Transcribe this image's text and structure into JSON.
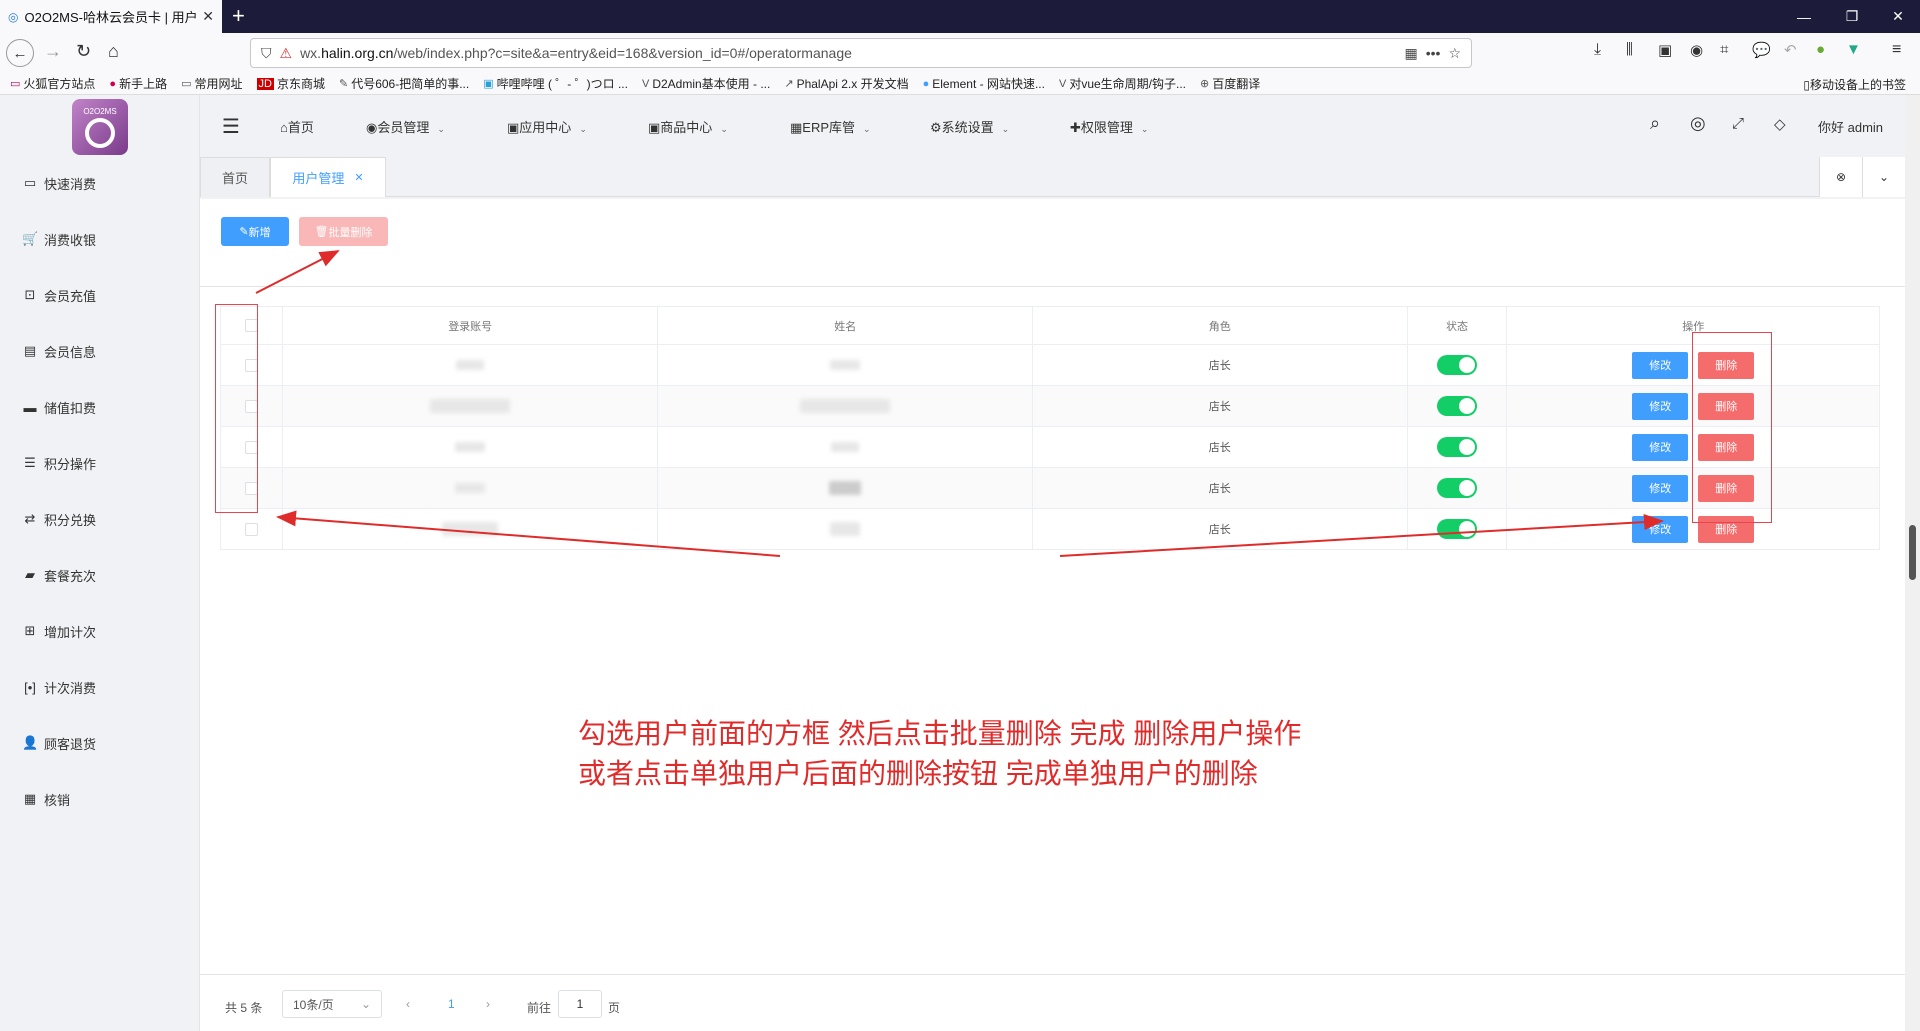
{
  "browser": {
    "tab_title": "O2O2MS-哈林云会员卡 | 用户",
    "url_prefix": "wx.",
    "url_domain": "halin.org.cn",
    "url_path": "/web/index.php?c=site&a=entry&eid=168&version_id=0#/operatormanage",
    "bookmarks": [
      "火狐官方站点",
      "新手上路",
      "常用网址",
      "京东商城",
      "代号606-把简单的事...",
      "哔哩哔哩 ( ゜- ゜)つロ ...",
      "D2Admin基本使用 - ...",
      "PhalApi 2.x 开发文档",
      "Element - 网站快速...",
      "对vue生命周期/钩子...",
      "百度翻译"
    ],
    "bookmarks_right": "移动设备上的书签"
  },
  "logo": {
    "text": "O2O2MS"
  },
  "sidebar": {
    "items": [
      {
        "icon": "credit-card-icon",
        "label": "快速消费"
      },
      {
        "icon": "cart-icon",
        "label": "消费收银"
      },
      {
        "icon": "money-icon",
        "label": "会员充值"
      },
      {
        "icon": "id-card-icon",
        "label": "会员信息"
      },
      {
        "icon": "card-icon",
        "label": "储值扣费"
      },
      {
        "icon": "database-icon",
        "label": "积分操作"
      },
      {
        "icon": "exchange-icon",
        "label": "积分兑换"
      },
      {
        "icon": "briefcase-icon",
        "label": "套餐充次"
      },
      {
        "icon": "plus-square-icon",
        "label": "增加计次"
      },
      {
        "icon": "bracket-icon",
        "label": "计次消费"
      },
      {
        "icon": "user-times-icon",
        "label": "顾客退货"
      },
      {
        "icon": "qrcode-icon",
        "label": "核销"
      }
    ]
  },
  "topnav": {
    "items": [
      "首页",
      "会员管理",
      "应用中心",
      "商品中心",
      "ERP库管",
      "系统设置",
      "权限管理"
    ],
    "greeting": "你好 admin"
  },
  "pagetabs": {
    "home": "首页",
    "active": "用户管理"
  },
  "toolbar": {
    "add_label": "新增",
    "batch_delete_label": "批量删除"
  },
  "table": {
    "headers": [
      "登录账号",
      "姓名",
      "角色",
      "状态",
      "操作"
    ],
    "rows": [
      {
        "role": "店长",
        "enabled": true
      },
      {
        "role": "店长",
        "enabled": true
      },
      {
        "role": "店长",
        "enabled": true
      },
      {
        "role": "店长",
        "enabled": true
      },
      {
        "role": "店长",
        "enabled": true
      }
    ],
    "edit_label": "修改",
    "delete_label": "删除"
  },
  "annotation": {
    "line1": "勾选用户前面的方框 然后点击批量删除 完成 删除用户操作",
    "line2": "或者点击单独用户后面的删除按钮 完成单独用户的删除"
  },
  "pagination": {
    "total": "共 5 条",
    "page_size": "10条/页",
    "current_page": "1",
    "goto_prefix": "前往",
    "goto_value": "1",
    "goto_suffix": "页"
  },
  "colors": {
    "primary": "#409eff",
    "danger": "#f56c6c",
    "switch_on": "#13ce66",
    "annotation": "#e02b2b"
  }
}
